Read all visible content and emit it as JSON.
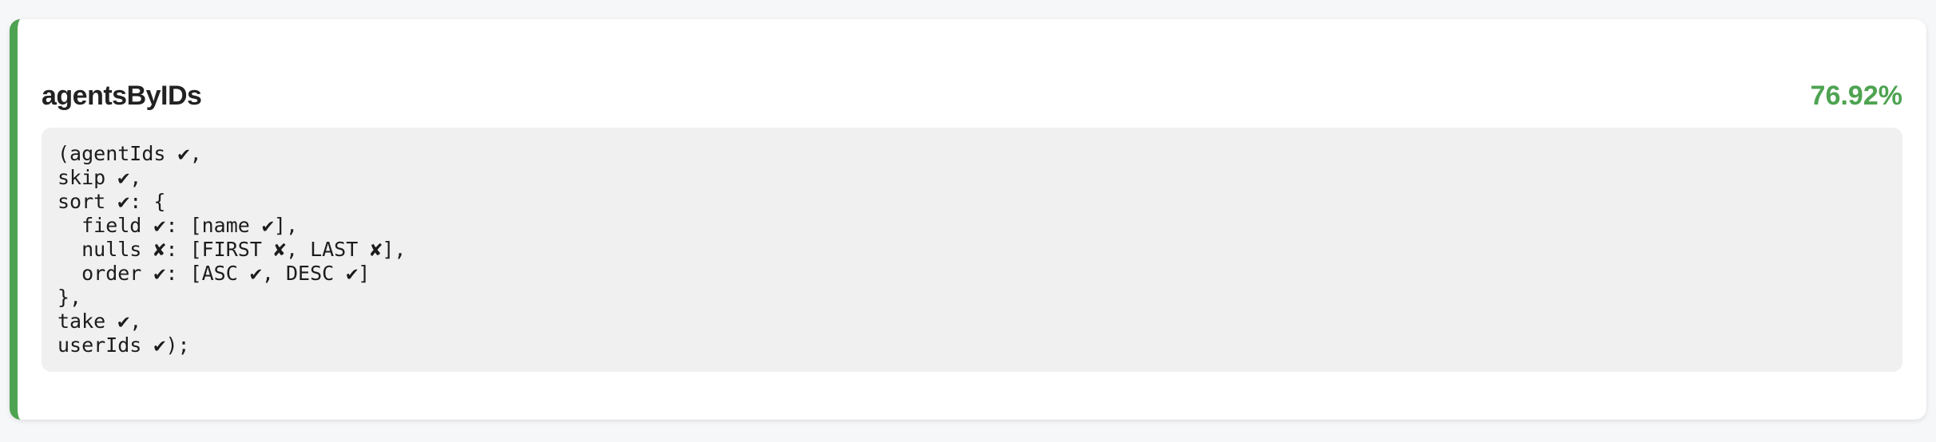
{
  "item": {
    "title": "agentsByIDs",
    "percent": "76.92%",
    "accent_color": "#4ea351",
    "code_lines": [
      "(agentIds ✔,",
      "skip ✔,",
      "sort ✔: {",
      "  field ✔: [name ✔],",
      "  nulls ✘: [FIRST ✘, LAST ✘],",
      "  order ✔: [ASC ✔, DESC ✔]",
      "},",
      "take ✔,",
      "userIds ✔);"
    ]
  }
}
